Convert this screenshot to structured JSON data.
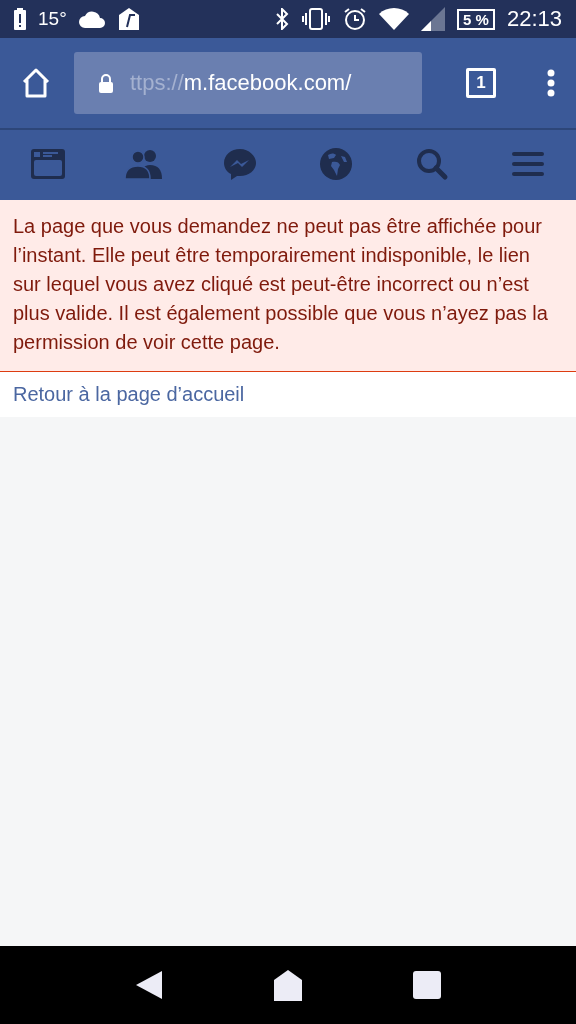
{
  "status_bar": {
    "temperature": "15°",
    "battery": "5 %",
    "time": "22:13"
  },
  "browser": {
    "url_scheme": "ttps://",
    "url_host": "m.facebook.com/",
    "tab_count": "1"
  },
  "nav_tabs": [
    {
      "kind": "feed",
      "selected": false
    },
    {
      "kind": "friends",
      "selected": false
    },
    {
      "kind": "messenger",
      "selected": false
    },
    {
      "kind": "globe",
      "selected": false
    },
    {
      "kind": "search",
      "selected": false
    },
    {
      "kind": "menu",
      "selected": false
    }
  ],
  "error": {
    "message": "La page que vous demandez ne peut pas être affichée pour l’instant. Elle peut être temporairement indisponible, le lien sur lequel vous avez cliqué est peut-être incorrect ou n’est plus valide. Il est également possible que vous n’ayez pas la permission de voir cette page."
  },
  "home_link": "Retour à la page d’accueil"
}
